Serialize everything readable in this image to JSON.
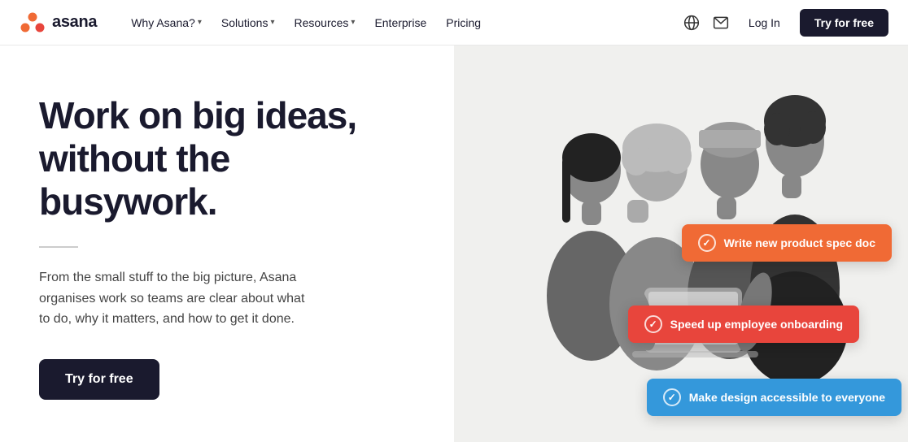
{
  "nav": {
    "logo_text": "asana",
    "links": [
      {
        "label": "Why Asana?",
        "has_dropdown": true
      },
      {
        "label": "Solutions",
        "has_dropdown": true
      },
      {
        "label": "Resources",
        "has_dropdown": true
      },
      {
        "label": "Enterprise",
        "has_dropdown": false
      },
      {
        "label": "Pricing",
        "has_dropdown": false
      }
    ],
    "globe_icon": "🌐",
    "mail_icon": "✉",
    "login_label": "Log In",
    "cta_label": "Try for free"
  },
  "hero": {
    "title_line1": "Work on big ideas,",
    "title_line2": "without the busywork.",
    "description": "From the small stuff to the big picture, Asana organises work so teams are clear about what to do, why it matters, and how to get it done.",
    "cta_label": "Try for free"
  },
  "task_chips": [
    {
      "id": "chip1",
      "label": "Write new product spec doc",
      "color": "orange"
    },
    {
      "id": "chip2",
      "label": "Speed up employee onboarding",
      "color": "red"
    },
    {
      "id": "chip3",
      "label": "Make design accessible to everyone",
      "color": "blue"
    }
  ],
  "colors": {
    "orange": "#f06a35",
    "red": "#e8453c",
    "blue": "#3498db",
    "dark": "#1a1a2e"
  }
}
